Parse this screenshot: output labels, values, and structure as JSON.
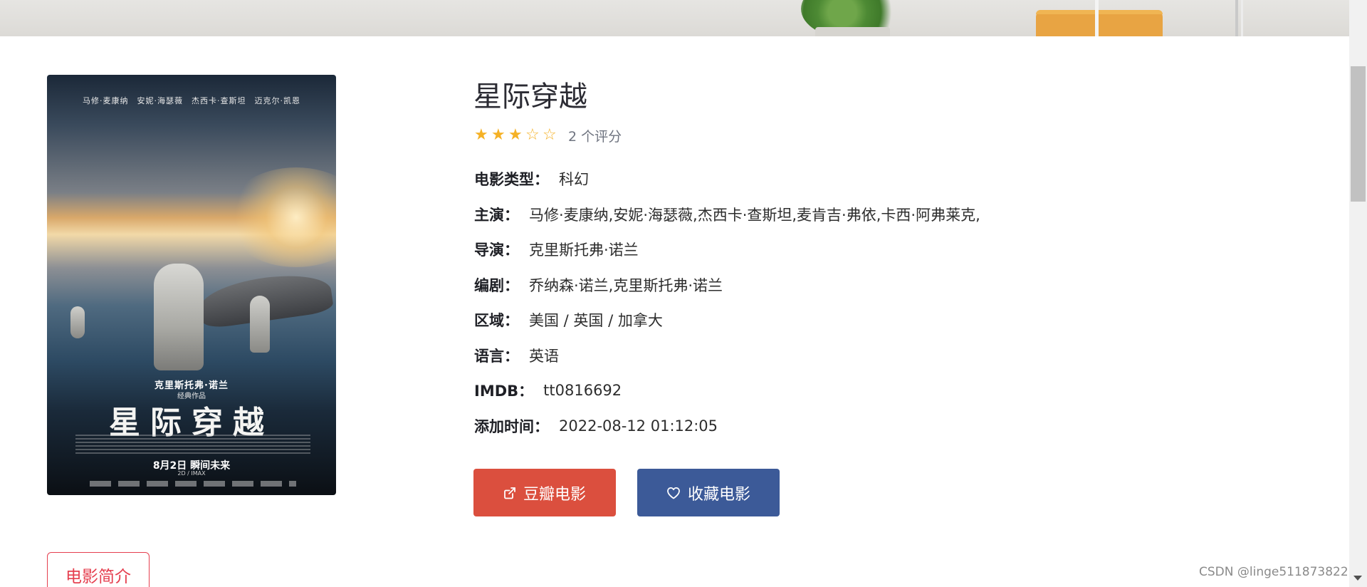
{
  "movie": {
    "title": "星际穿越",
    "rating_stars": 3,
    "rating_max": 5,
    "rating_count": "2 个评分",
    "fields": [
      {
        "label": "电影类型：",
        "value": "科幻"
      },
      {
        "label": "主演：",
        "value": "马修·麦康纳,安妮·海瑟薇,杰西卡·查斯坦,麦肯吉·弗依,卡西·阿弗莱克,"
      },
      {
        "label": "导演：",
        "value": "克里斯托弗·诺兰"
      },
      {
        "label": "编剧：",
        "value": "乔纳森·诺兰,克里斯托弗·诺兰"
      },
      {
        "label": "区域：",
        "value": "美国 / 英国 / 加拿大"
      },
      {
        "label": "语言：",
        "value": "英语"
      },
      {
        "label": "IMDB：",
        "value": "tt0816692"
      },
      {
        "label": "添加时间：",
        "value": "2022-08-12 01:12:05"
      }
    ]
  },
  "poster": {
    "cast_line": "马修·麦康纳　安妮·海瑟薇　杰西卡·查斯坦　迈克尔·凯恩",
    "director": "克里斯托弗·诺兰",
    "works": "经典作品",
    "big_title": "星际穿越",
    "release": "8月2日 瞬间未来",
    "format": "2D / IMAX"
  },
  "buttons": {
    "douban_label": "豆瓣电影",
    "douban_icon": "external-link-icon",
    "douban_color": "#db4f3e",
    "collect_label": "收藏电影",
    "collect_icon": "heart-icon",
    "collect_color": "#3c5a98"
  },
  "tabs": {
    "intro_label": "电影简介"
  },
  "watermark": "CSDN @linge511873822"
}
